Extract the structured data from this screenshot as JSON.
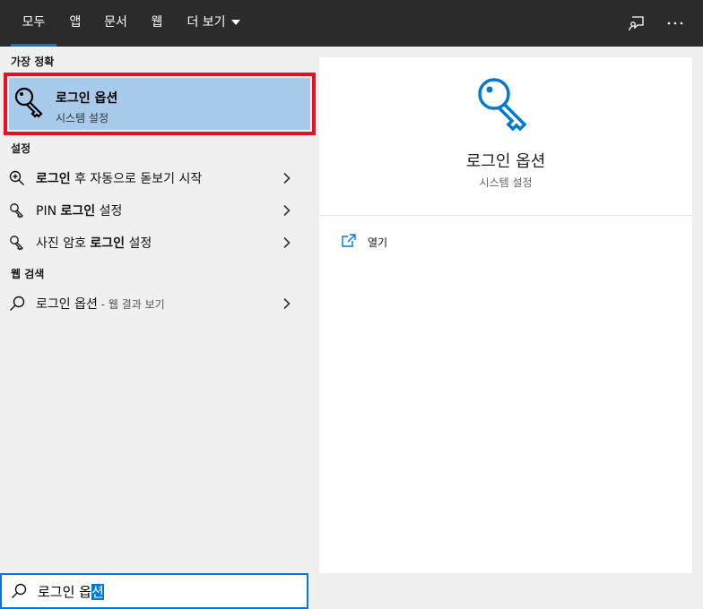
{
  "tabs": [
    {
      "label": "모두"
    },
    {
      "label": "앱"
    },
    {
      "label": "문서"
    },
    {
      "label": "웹"
    },
    {
      "label": "더 보기"
    }
  ],
  "topbar_icons": [
    "feedback-icon",
    "more-options-icon"
  ],
  "best_match": {
    "section_title": "가장 정확",
    "title": "로그인 옵션",
    "subtitle": "시스템 설정",
    "icon": "key-icon"
  },
  "settings": {
    "section_title": "설정",
    "items": [
      {
        "bold": "로그인",
        "rest": " 후 자동으로 돋보기 시작",
        "prefix": ""
      },
      {
        "prefix": "PIN ",
        "bold": "로그인",
        "rest": " 설정"
      },
      {
        "prefix": "사진 암호 ",
        "bold": "로그인",
        "rest": " 설정"
      }
    ]
  },
  "web_search": {
    "section_title": "웹 검색",
    "item": {
      "label": "로그인 옵션",
      "suffix": " - 웹 결과 보기"
    }
  },
  "detail": {
    "title": "로그인 옵션",
    "subtitle": "시스템 설정",
    "action_label": "열기"
  },
  "search": {
    "typed": "로그인 옵",
    "selected": "션"
  },
  "colors": {
    "accent": "#0078d7",
    "highlight": "#a9cbeb",
    "outline": "#e81123",
    "topbar": "#2b2b2b"
  }
}
